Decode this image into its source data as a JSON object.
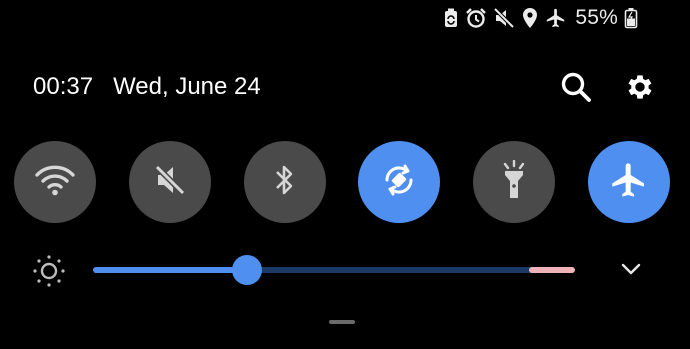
{
  "status_bar": {
    "icons": [
      "recycle-battery-icon",
      "alarm-icon",
      "mute-icon",
      "location-icon",
      "airplane-icon",
      "battery-icon"
    ],
    "battery_percent": "55%"
  },
  "header": {
    "time": "00:37",
    "date": "Wed, June 24",
    "actions": [
      "search-icon",
      "gear-icon"
    ]
  },
  "quick_tiles": [
    {
      "name": "wifi",
      "icon": "wifi-icon",
      "active": false
    },
    {
      "name": "sound",
      "icon": "mute-icon",
      "active": false
    },
    {
      "name": "bluetooth",
      "icon": "bluetooth-icon",
      "active": false
    },
    {
      "name": "auto-rotate",
      "icon": "rotate-icon",
      "active": true
    },
    {
      "name": "flashlight",
      "icon": "flashlight-icon",
      "active": false
    },
    {
      "name": "airplane-mode",
      "icon": "airplane-icon",
      "active": true
    }
  ],
  "brightness": {
    "level": 0.32,
    "icon": "brightness-icon"
  },
  "colors": {
    "accent": "#4f8ff0",
    "tile_inactive": "#4a4a4a",
    "background": "#000000",
    "track_end": "#f0b4b8"
  }
}
